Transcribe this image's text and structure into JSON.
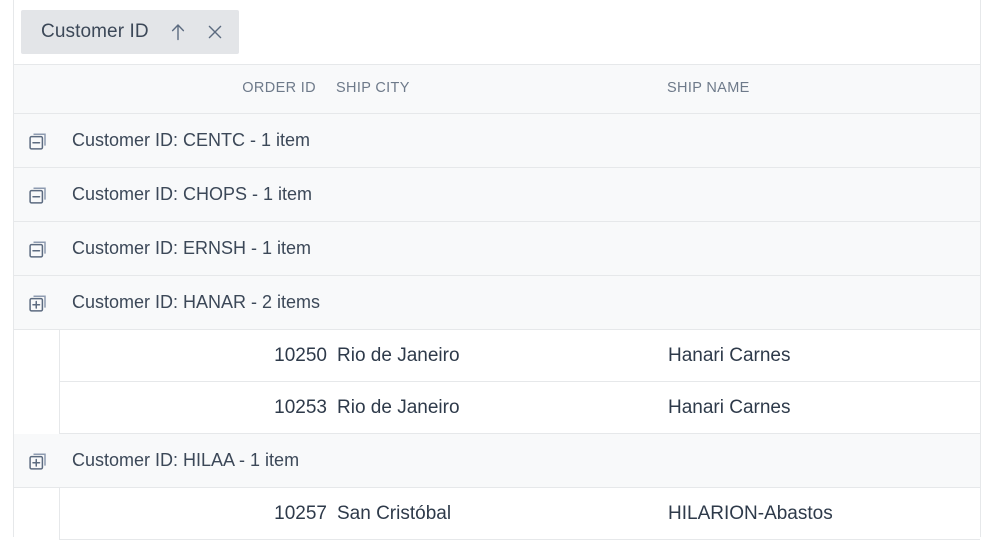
{
  "group_panel": {
    "chip": {
      "label": "Customer ID",
      "sort_icon": "sort-ascending-arrow-icon",
      "sort_direction": "ascending",
      "close_icon": "close-icon"
    }
  },
  "columns": [
    {
      "key": "order_id",
      "label": "ORDER ID",
      "align": "right"
    },
    {
      "key": "ship_city",
      "label": "SHIP CITY",
      "align": "left"
    },
    {
      "key": "ship_name",
      "label": "SHIP NAME",
      "align": "left"
    }
  ],
  "rows": [
    {
      "type": "group",
      "icon": "collapse-group-icon",
      "expanded": false,
      "text": "Customer ID: CENTC - 1 item"
    },
    {
      "type": "group",
      "icon": "collapse-group-icon",
      "expanded": false,
      "text": "Customer ID: CHOPS - 1 item"
    },
    {
      "type": "group",
      "icon": "collapse-group-icon",
      "expanded": false,
      "text": "Customer ID: ERNSH - 1 item"
    },
    {
      "type": "group",
      "icon": "expand-group-icon",
      "expanded": true,
      "text": "Customer ID: HANAR - 2 items"
    },
    {
      "type": "detail",
      "order_id": "10250",
      "ship_city": "Rio de Janeiro",
      "ship_name": "Hanari Carnes"
    },
    {
      "type": "detail",
      "order_id": "10253",
      "ship_city": "Rio de Janeiro",
      "ship_name": "Hanari Carnes"
    },
    {
      "type": "group",
      "icon": "expand-group-icon",
      "expanded": true,
      "text": "Customer ID: HILAA - 1 item"
    },
    {
      "type": "detail",
      "order_id": "10257",
      "ship_city": "San Cristóbal",
      "ship_name": "HILARION-Abastos"
    }
  ],
  "colors": {
    "chip_bg": "#e3e5e8",
    "header_bg": "#f8f9fa",
    "group_row_bg": "#f8f9fa",
    "detail_row_bg": "#ffffff",
    "border": "#e6e8ea",
    "text": "#3c4858",
    "muted_text": "#6e7a8a"
  }
}
